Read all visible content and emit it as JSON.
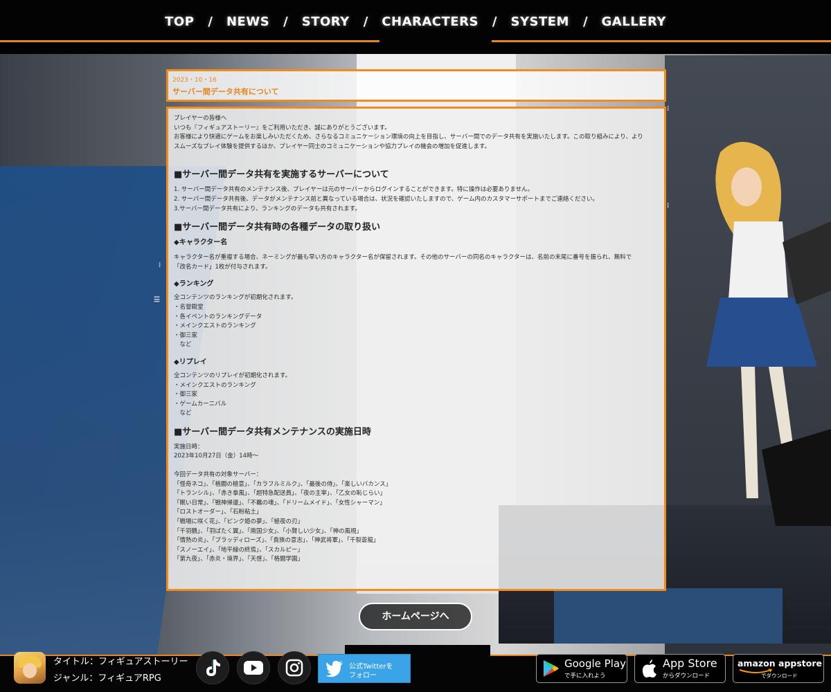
{
  "nav": {
    "items": [
      "TOP",
      "NEWS",
      "STORY",
      "CHARACTERS",
      "SYSTEM",
      "GALLERY"
    ],
    "separator": "/"
  },
  "news": {
    "date": "2023・10・16",
    "title": "サーバー間データ共有について"
  },
  "article": {
    "intro": [
      "プレイヤーの皆様へ",
      "いつも『フィギュアストーリー』をご利用いただき、誠にありがとうございます。",
      "お客様により快適にゲームをお楽しみいただくため、さらなるコミュニケーション環境の向上を目指し、サーバー間でのデータ共有を実施いたします。この取り組みにより、より",
      "スムーズなプレイ体験を提供するほか、プレイヤー同士のコミュニケーションや協力プレイの機会の増加を促進します。"
    ],
    "section1_title": "■サーバー間データ共有を実施するサーバーについて",
    "section1_items": [
      "1. サーバー間データ共有のメンテナンス後、プレイヤーは元のサーバーからログインすることができます。特に操作は必要ありません。",
      "2. サーバー間データ共有後、データがメンテナンス前と異なっている場合は、状況を確認いたしますので、ゲーム内のカスタマーサポートまでご連絡ください。",
      "3.サーバー間データ共有により、ランキングのデータも共有されます。"
    ],
    "section2_title": "■サーバー間データ共有時の各種データの取り扱い",
    "character_title": "◆キャラクター名",
    "character_text": [
      "キャラクター名が重複する場合、ネーミングが最も早い方のキャラクター名が保留されます。その他のサーバーの同名のキャラクターは、名前の末尾に番号を振られ、無料で",
      "「改名カード」1枚が付与されます。"
    ],
    "ranking_title": "◆ランキング",
    "ranking_text": [
      "全コンテンツのランキングが初期化されます。",
      "・名誉殿堂",
      "・各イベントのランキングデータ",
      "・メインクエストのランキング",
      "・御三家",
      "　など"
    ],
    "replay_title": "◆リプレイ",
    "replay_text": [
      "全コンテンツのリプレイが初期化されます。",
      "・メインクエストのランキング",
      "・御三家",
      "・ゲームカーニバル",
      "　など"
    ],
    "section3_title": "■サーバー間データ共有メンテナンスの実施日時",
    "schedule_text": [
      "実施日時：",
      "2023年10月27日（金）14時～"
    ],
    "servers_label": "今回データ共有の対象サーバー：",
    "servers": [
      "「怪奇ネコ」、「格闘の極意」、「カラフルミルク」、「最後の侍」、「楽しいバカンス」",
      "「トランシル」、「赤き拳風」、「超特急配送員」、「夜の主宰」、「乙女の恥じらい」",
      "「眠い日常」、「戦神帰還」、「不羈の魂」、「ドリームメイド」、「女性シャーマン」",
      "「ロストオーダー」、「石粉粘土」",
      "「戦場に咲く花」、「ピンク姫の夢」、「極夜の刃」",
      "「千羽鶴」、「羽ばたく翼」、「南国少女」、「小賢しい少女」、「神の風視」",
      "「情熱の炎」、「ブラッディローズ」、「貴族の意志」、「神武将軍」、「千裂蒼龍」",
      "「スノーエイ」、「地平線の終焉」、「スカルピー」",
      "「第九夜」、「赤炎・境界」、「天啓」、「格闘学園」"
    ]
  },
  "home_button": "ホームページへ",
  "footer": {
    "title": "タイトル：フィギュアストーリー",
    "genre": "ジャンル：フィギュアRPG",
    "twitter_line1": "公式Twitterを",
    "twitter_line2": "フォロー",
    "google_big": "Google Play",
    "google_small": "で手に入れよう",
    "apple_big": "App Store",
    "apple_small": "からダウンロード",
    "amazon_big": "amazon appstore",
    "amazon_small": "でダウンロード"
  },
  "colors": {
    "accent": "#f08b1d",
    "twitter": "#3ba3e8"
  },
  "icons": [
    "tiktok-icon",
    "youtube-icon",
    "instagram-icon",
    "twitter-icon",
    "google-play-icon",
    "apple-icon"
  ]
}
